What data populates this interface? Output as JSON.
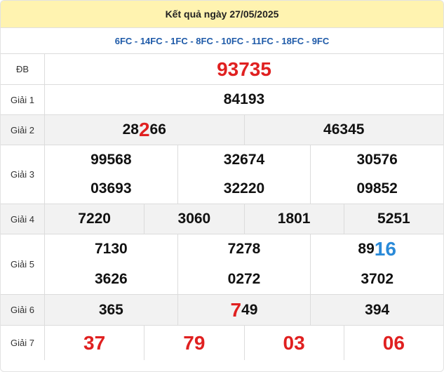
{
  "header": {
    "title": "Kết quả ngày 27/05/2025"
  },
  "codes": "6FC - 14FC - 1FC - 8FC - 10FC - 11FC - 18FC - 9FC",
  "prizes": {
    "db": {
      "label": "ĐB",
      "value": "93735"
    },
    "g1": {
      "label": "Giải 1",
      "value": "84193"
    },
    "g2": {
      "label": "Giải 2",
      "values": [
        {
          "pre": "28",
          "hl": "2",
          "post": "66"
        },
        {
          "pre": "46345",
          "hl": "",
          "post": ""
        }
      ]
    },
    "g3": {
      "label": "Giải 3",
      "values": [
        "99568",
        "32674",
        "30576",
        "03693",
        "32220",
        "09852"
      ]
    },
    "g4": {
      "label": "Giải 4",
      "values": [
        "7220",
        "3060",
        "1801",
        "5251"
      ]
    },
    "g5": {
      "label": "Giải 5",
      "values": [
        {
          "pre": "7130",
          "hl": ""
        },
        {
          "pre": "7278",
          "hl": ""
        },
        {
          "pre": "89",
          "hl": "16"
        },
        {
          "pre": "3626",
          "hl": ""
        },
        {
          "pre": "0272",
          "hl": ""
        },
        {
          "pre": "3702",
          "hl": ""
        }
      ]
    },
    "g6": {
      "label": "Giải 6",
      "values": [
        {
          "pre": "365",
          "hl": "",
          "post": ""
        },
        {
          "pre": "",
          "hl": "7",
          "post": "49"
        },
        {
          "pre": "394",
          "hl": "",
          "post": ""
        }
      ]
    },
    "g7": {
      "label": "Giải 7",
      "values": [
        "37",
        "79",
        "03",
        "06"
      ]
    }
  },
  "colors": {
    "header_bg": "#fff3b0",
    "codes": "#1e5aa8",
    "red": "#e02020",
    "blue": "#2a8ad8",
    "row_alt": "#f2f2f2"
  }
}
